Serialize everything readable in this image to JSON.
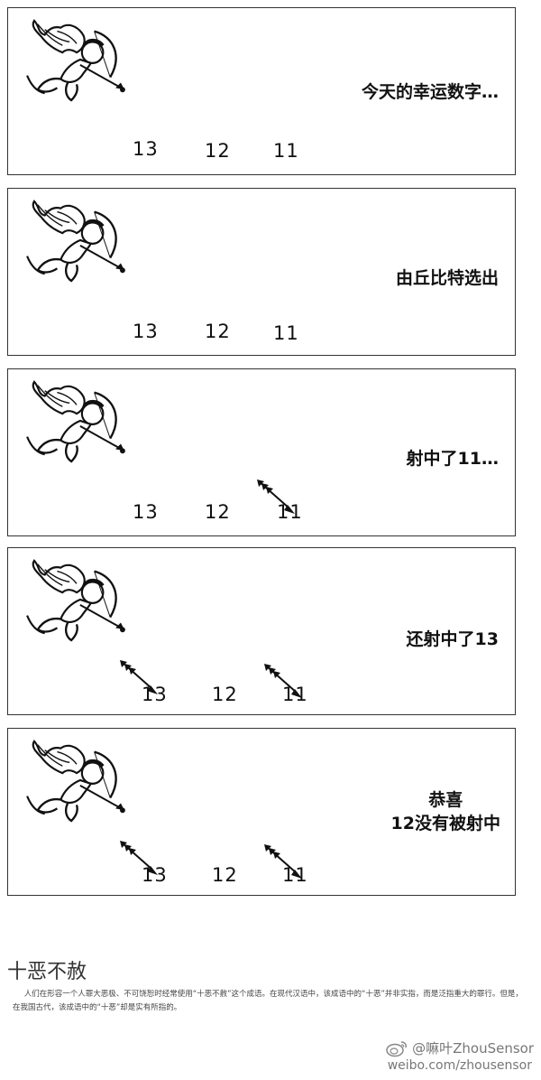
{
  "panels": [
    {
      "caption": [
        "今天的幸运数字…"
      ],
      "numbers": [
        "13",
        "12",
        "11"
      ]
    },
    {
      "caption": [
        "由丘比特选出"
      ],
      "numbers": [
        "13",
        "12",
        "11"
      ]
    },
    {
      "caption": [
        "射中了11…"
      ],
      "numbers": [
        "13",
        "12",
        "11"
      ]
    },
    {
      "caption": [
        "还射中了13"
      ],
      "numbers": [
        "13",
        "12",
        "11"
      ]
    },
    {
      "caption": [
        "恭喜",
        "12没有被射中"
      ],
      "numbers": [
        "13",
        "12",
        "11"
      ]
    }
  ],
  "article": {
    "title": "十恶不赦",
    "body": "人们在形容一个人罪大恶极、不可饶恕时经常使用“十恶不赦”这个成语。在现代汉语中，该成语中的“十恶”并非实指，而是泛指重大的罪行。但是，在我国古代，该成语中的“十恶”却是实有所指的。"
  },
  "watermark": {
    "handle": "@嘛叶ZhouSensor",
    "url": "weibo.com/zhousensor"
  }
}
